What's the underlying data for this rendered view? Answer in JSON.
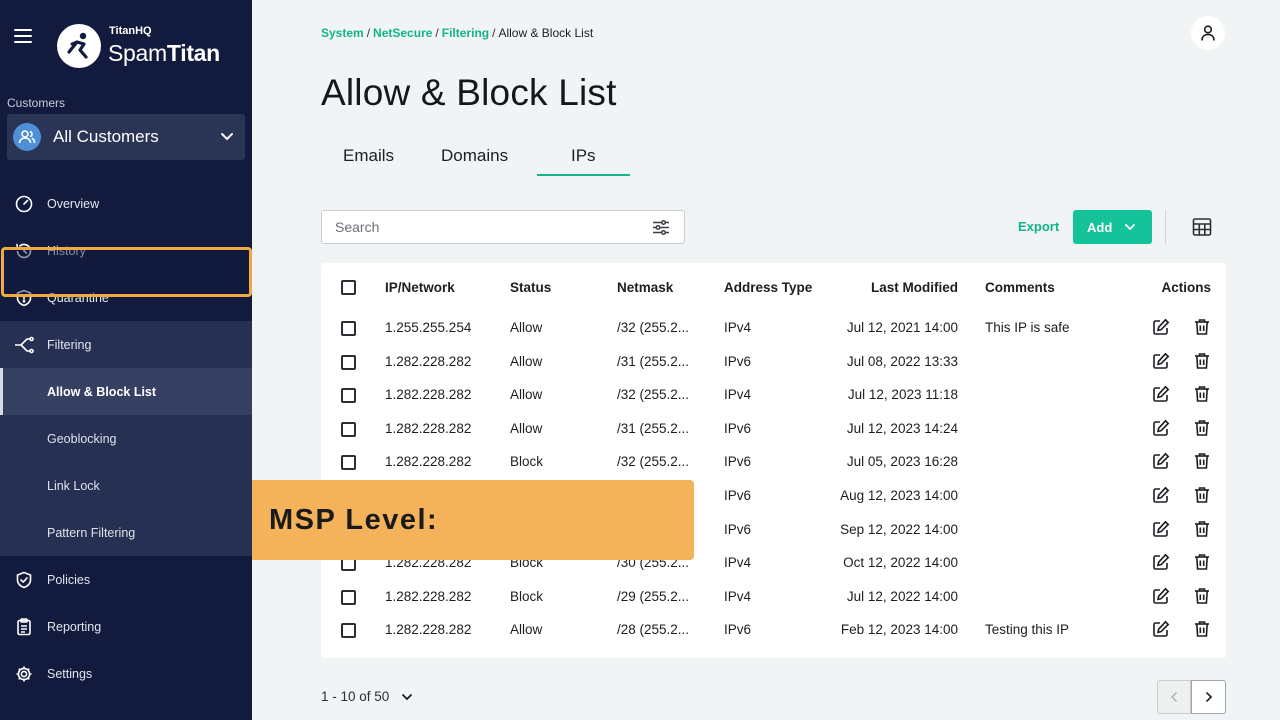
{
  "app": {
    "brand_small": "TitanHQ",
    "brand_name_light": "Spam",
    "brand_name_bold": "Titan"
  },
  "sidebar": {
    "customers_label": "Customers",
    "customer_selected": "All Customers",
    "items": [
      {
        "label": "Overview",
        "icon": "gauge-icon"
      },
      {
        "label": "History",
        "icon": "history-icon"
      },
      {
        "label": "Quarantine",
        "icon": "shield-icon"
      },
      {
        "label": "Filtering",
        "icon": "filter-branch-icon"
      },
      {
        "label": "Policies",
        "icon": "policy-shield-icon"
      },
      {
        "label": "Reporting",
        "icon": "clipboard-icon"
      },
      {
        "label": "Settings",
        "icon": "gear-icon"
      }
    ],
    "sub_items": [
      {
        "label": "Allow & Block List"
      },
      {
        "label": "Geoblocking"
      },
      {
        "label": "Link Lock"
      },
      {
        "label": "Pattern Filtering"
      }
    ]
  },
  "breadcrumb": {
    "items": [
      "System",
      "NetSecure",
      "Filtering"
    ],
    "current": "Allow & Block List",
    "separator": "/"
  },
  "page": {
    "title": "Allow & Block List",
    "tabs": [
      {
        "label": "Emails"
      },
      {
        "label": "Domains"
      },
      {
        "label": "IPs"
      }
    ],
    "active_tab": "IPs"
  },
  "toolbar": {
    "search_placeholder": "Search",
    "export_label": "Export",
    "add_label": "Add"
  },
  "table": {
    "headers": [
      "IP/Network",
      "Status",
      "Netmask",
      "Address Type",
      "Last Modified",
      "Comments",
      "Actions"
    ],
    "rows": [
      {
        "ip": "1.255.255.254",
        "status": "Allow",
        "netmask": "/32 (255.2...",
        "type": "IPv4",
        "modified": "Jul 12, 2021 14:00",
        "comment": "This IP is safe"
      },
      {
        "ip": "1.282.228.282",
        "status": "Allow",
        "netmask": "/31 (255.2...",
        "type": "IPv6",
        "modified": "Jul 08, 2022 13:33",
        "comment": ""
      },
      {
        "ip": "1.282.228.282",
        "status": "Allow",
        "netmask": "/32 (255.2...",
        "type": "IPv4",
        "modified": "Jul 12, 2023 11:18",
        "comment": ""
      },
      {
        "ip": "1.282.228.282",
        "status": "Allow",
        "netmask": "/31 (255.2...",
        "type": "IPv6",
        "modified": "Jul 12, 2023 14:24",
        "comment": ""
      },
      {
        "ip": "1.282.228.282",
        "status": "Block",
        "netmask": "/32 (255.2...",
        "type": "IPv6",
        "modified": "Jul 05, 2023 16:28",
        "comment": ""
      },
      {
        "ip": "",
        "status": "",
        "netmask": "",
        "type": "IPv6",
        "modified": "Aug 12, 2023 14:00",
        "comment": ""
      },
      {
        "ip": "",
        "status": "",
        "netmask": "",
        "type": "IPv6",
        "modified": "Sep 12, 2022 14:00",
        "comment": ""
      },
      {
        "ip": "1.282.228.282",
        "status": "Block",
        "netmask": "/30 (255.2...",
        "type": "IPv4",
        "modified": "Oct 12, 2022 14:00",
        "comment": ""
      },
      {
        "ip": "1.282.228.282",
        "status": "Block",
        "netmask": "/29 (255.2...",
        "type": "IPv4",
        "modified": "Jul 12, 2022 14:00",
        "comment": ""
      },
      {
        "ip": "1.282.228.282",
        "status": "Allow",
        "netmask": "/28 (255.2...",
        "type": "IPv6",
        "modified": "Feb 12, 2023 14:00",
        "comment": "Testing this IP"
      }
    ]
  },
  "pagination": {
    "range_text": "1 - 10 of 50"
  },
  "overlay": {
    "caption": "MSP Level:"
  },
  "colors": {
    "sidebar_bg": "#121b3d",
    "accent_green": "#14c39a",
    "highlight_orange": "#f2aa3f",
    "overlay_bg": "#f4b35a"
  }
}
